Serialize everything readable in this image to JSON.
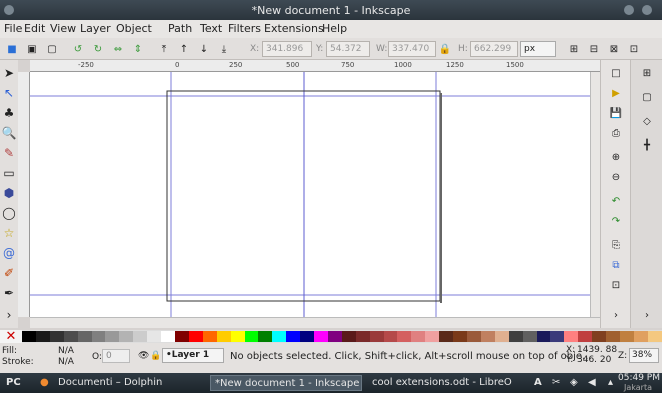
{
  "window": {
    "title": "*New document 1 - Inkscape"
  },
  "menu": [
    "File",
    "Edit",
    "View",
    "Layer",
    "Object",
    "Path",
    "Text",
    "Filters",
    "Extensions",
    "Help"
  ],
  "toolbar": {
    "x_label": "X:",
    "x_value": "341.896",
    "y_label": "Y:",
    "y_value": "54.372",
    "w_label": "W:",
    "w_value": "337.470",
    "h_label": "H:",
    "h_value": "662.299",
    "units": "px"
  },
  "ruler": {
    "ticks": [
      "-250",
      "0",
      "250",
      "500",
      "750",
      "1000",
      "1250",
      "1500"
    ]
  },
  "palette": {
    "none_icon": "x-icon",
    "colors": [
      "#000000",
      "#1a1a1a",
      "#333333",
      "#4d4d4d",
      "#666666",
      "#808080",
      "#999999",
      "#b3b3b3",
      "#cccccc",
      "#e6e6e6",
      "#ffffff",
      "#800000",
      "#ff0000",
      "#ff6600",
      "#ffcc00",
      "#ffff00",
      "#00ff00",
      "#008000",
      "#00ffff",
      "#0000ff",
      "#000080",
      "#ff00ff",
      "#800080",
      "#5a1a1a",
      "#7a2a2a",
      "#9a3a3a",
      "#b54a4a",
      "#d46060",
      "#e08080",
      "#f0a0a0",
      "#5a2a1a",
      "#7a3a1a",
      "#9a5a3a",
      "#c08060",
      "#e0b090",
      "#404040",
      "#606060",
      "#1a1a5a",
      "#3a3a7a",
      "#ff8080",
      "#c04040",
      "#804020",
      "#a06030",
      "#c08040",
      "#e0a060",
      "#f4c880"
    ]
  },
  "status": {
    "fill_label": "Fill:",
    "fill_value": "N/A",
    "stroke_label": "Stroke:",
    "stroke_value": "N/A",
    "opacity_label": "O:",
    "opacity_value": "0",
    "layer": "•Layer 1",
    "message": "No objects selected. Click, Shift+click, Alt+scroll mouse on top of obje...",
    "x_label": "X:",
    "x_value": "1439. 88",
    "y_label": "Y:",
    "y_value": "346. 20",
    "zoom_label": "Z:",
    "zoom_value": "38%"
  },
  "taskbar": {
    "start_label": "PC",
    "tasks": [
      "Documenti – Dolphin",
      "*New document 1 - Inkscape",
      "cool extensions.odt - LibreO"
    ],
    "keyboard": "A",
    "time": "05:49 PM",
    "city": "Jakarta"
  }
}
